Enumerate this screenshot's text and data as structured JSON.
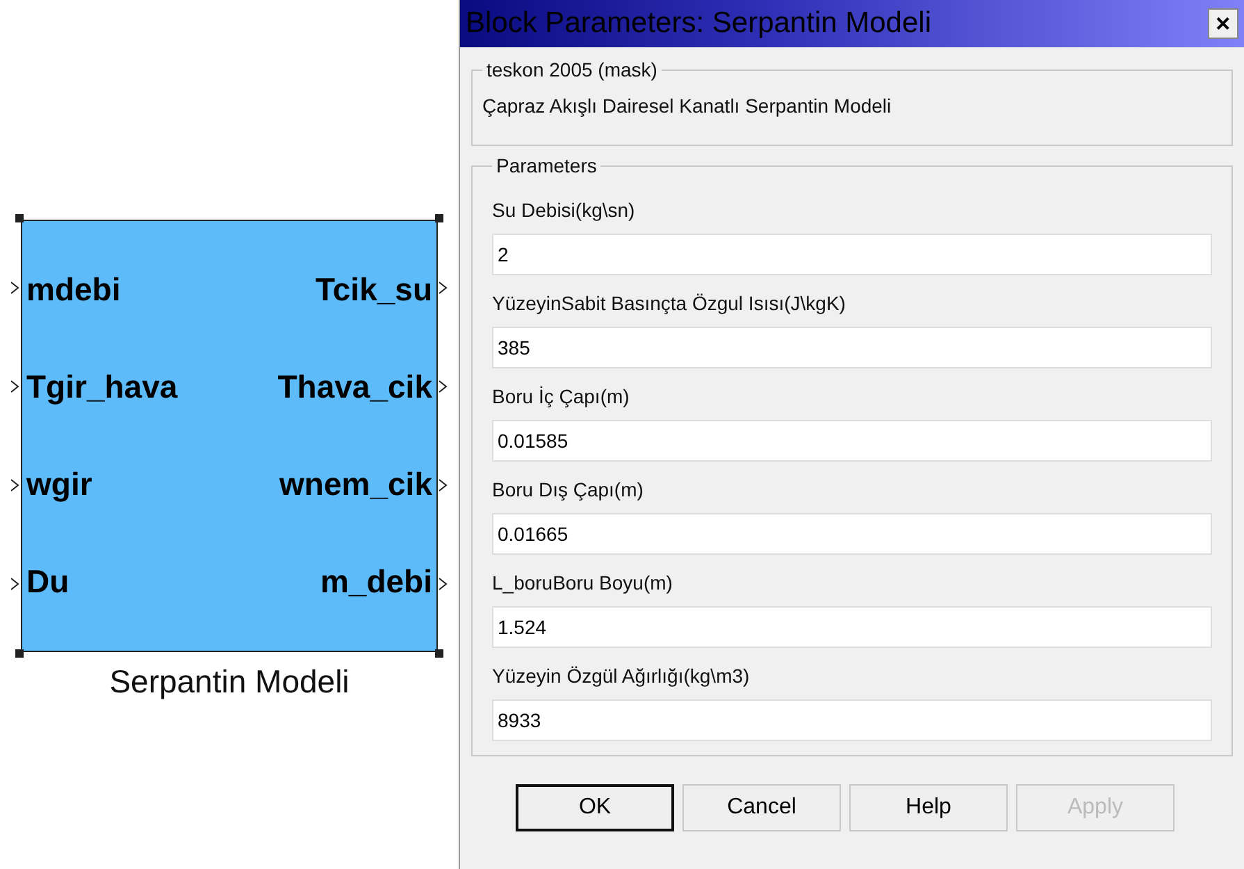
{
  "block": {
    "name": "Serpantin Modeli",
    "inputs": [
      "mdebi",
      "Tgir_hava",
      "wgir",
      "Du"
    ],
    "outputs": [
      "Tcik_su",
      "Thava_cik",
      "wnem_cik",
      "m_debi"
    ]
  },
  "window": {
    "title": "Block Parameters: Serpantin Modeli",
    "close": "✕"
  },
  "mask": {
    "legend": "teskon 2005 (mask)",
    "description": "Çapraz Akışlı Dairesel Kanatlı Serpantin Modeli"
  },
  "parameters": {
    "legend": "Parameters",
    "fields": [
      {
        "label": "Su Debisi(kg\\sn)",
        "value": "2"
      },
      {
        "label": "YüzeyinSabit Basınçta Özgul Isısı(J\\kgK)",
        "value": "385"
      },
      {
        "label": "Boru İç Çapı(m)",
        "value": "0.01585"
      },
      {
        "label": "Boru Dış Çapı(m)",
        "value": "0.01665"
      },
      {
        "label": "L_boruBoru Boyu(m)",
        "value": "1.524"
      },
      {
        "label": "Yüzeyin Özgül Ağırlığı(kg\\m3)",
        "value": "8933"
      }
    ]
  },
  "buttons": [
    {
      "label": "OK",
      "default": true,
      "disabled": false
    },
    {
      "label": "Cancel",
      "default": false,
      "disabled": false
    },
    {
      "label": "Help",
      "default": false,
      "disabled": false
    },
    {
      "label": "Apply",
      "default": false,
      "disabled": true
    }
  ]
}
